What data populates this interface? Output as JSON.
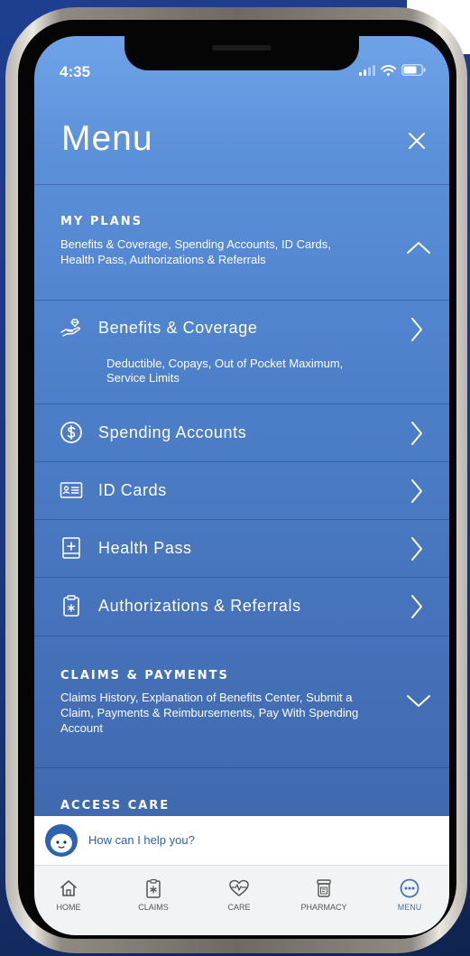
{
  "status_bar": {
    "time": "4:35"
  },
  "header": {
    "title": "Menu"
  },
  "sections": {
    "my_plans": {
      "heading": "MY PLANS",
      "description_line1": "Benefits & Coverage, Spending Accounts, ID Cards,",
      "description_line2": "Health Pass, Authorizations & Referrals"
    },
    "claims_payments": {
      "heading": "CLAIMS & PAYMENTS",
      "description_line1": "Claims History, Explanation of Benefits Center, Submit a",
      "description_line2": "Claim, Payments & Reimbursements, Pay With Spending",
      "description_line3": "Account"
    },
    "access_care": {
      "heading": "ACCESS CARE"
    }
  },
  "plan_items": [
    {
      "label": "Benefits & Coverage",
      "icon": "hand-coin-icon",
      "sub_line1": "Deductible, Copays, Out of Pocket Maximum,",
      "sub_line2": "Service Limits"
    },
    {
      "label": "Spending Accounts",
      "icon": "dollar-circle-icon"
    },
    {
      "label": "ID Cards",
      "icon": "id-card-icon"
    },
    {
      "label": "Health Pass",
      "icon": "health-pass-icon"
    },
    {
      "label": "Authorizations & Referrals",
      "icon": "clipboard-icon"
    }
  ],
  "chat": {
    "prompt": "How can I help you?"
  },
  "tabs": [
    {
      "label": "HOME",
      "icon": "home-icon"
    },
    {
      "label": "CLAIMS",
      "icon": "claims-icon"
    },
    {
      "label": "CARE",
      "icon": "heart-pulse-icon"
    },
    {
      "label": "PHARMACY",
      "icon": "pharmacy-icon"
    },
    {
      "label": "MENU",
      "icon": "more-icon",
      "active": true
    }
  ],
  "colors": {
    "accent": "#3f6fc6",
    "menu_bg": "#4d7fc9",
    "chat_text": "#2d62b3"
  }
}
